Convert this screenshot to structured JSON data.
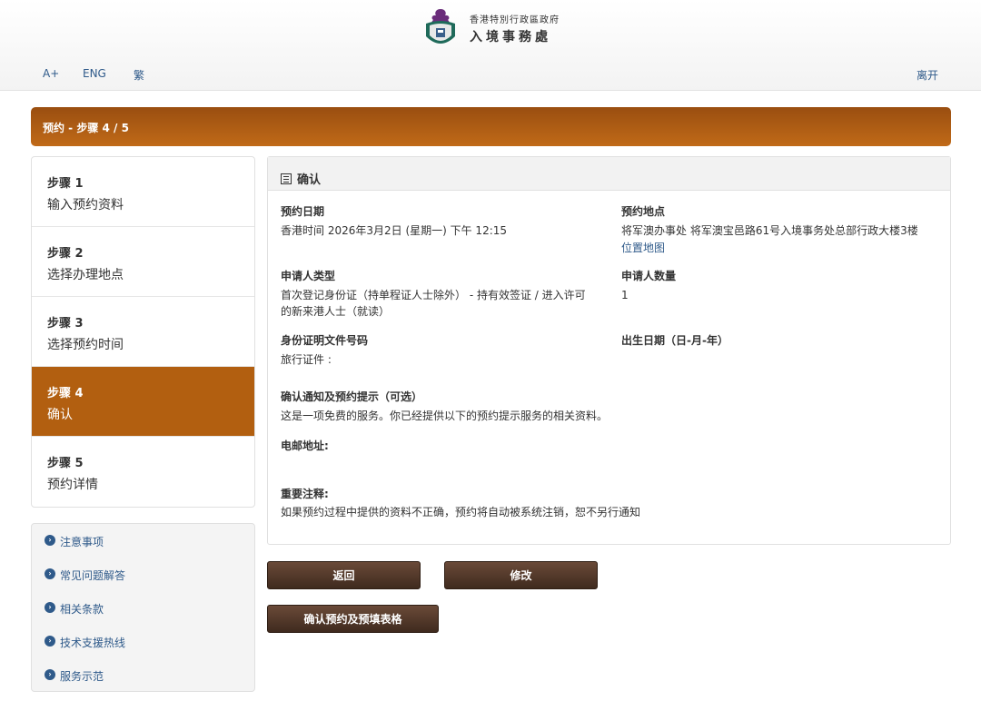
{
  "header": {
    "org_line1": "香港特別行政區政府",
    "org_line2": "入境事務處",
    "links": {
      "font_size": "A+",
      "english": "ENG",
      "traditional": "繁",
      "exit": "离开"
    }
  },
  "step_bar": {
    "title": "预约 - 步骤 4 / 5"
  },
  "steps": [
    {
      "num": "步骤 1",
      "name": "输入预约资料"
    },
    {
      "num": "步骤 2",
      "name": "选择办理地点"
    },
    {
      "num": "步骤 3",
      "name": "选择预约时间"
    },
    {
      "num": "步骤 4",
      "name": "确认"
    },
    {
      "num": "步骤 5",
      "name": "预约详情"
    }
  ],
  "side_links": [
    "注意事项",
    "常见问题解答",
    "相关条款",
    "技术支援热线",
    "服务示范"
  ],
  "panel": {
    "title": "确认",
    "date_label": "预约日期",
    "date_value": "香港时间 2026年3月2日 (星期一) 下午 12:15",
    "location_label": "预约地点",
    "location_value": "将军澳办事处 将军澳宝邑路61号入境事务处总部行政大楼3楼",
    "map_link": "位置地图",
    "applicant_type_label": "申请人类型",
    "applicant_type_line1": "首次登记身份证（持单程证人士除外） - 持有效签证 / 进入许可",
    "applicant_type_line2": "的新来港人士（就读）",
    "applicant_count_label": "申请人数量",
    "applicant_count_value": "1",
    "id_doc_label": "身份证明文件号码",
    "id_doc_value": "旅行证件 :",
    "dob_label": "出生日期（日-月-年）",
    "notify_label": "确认通知及预约提示（可选）",
    "notify_value": "这是一项免费的服务。你已经提供以下的预约提示服务的相关资料。",
    "email_label": "电邮地址:",
    "note_label": "重要注释:",
    "note_value": "如果预约过程中提供的资料不正确，预约将自动被系统注销，恕不另行通知"
  },
  "buttons": {
    "back": "返回",
    "edit": "修改",
    "confirm": "确认预约及预填表格"
  },
  "colors": {
    "accent": "#b25f10",
    "link": "#2f5a8a",
    "button": "#4f3628"
  }
}
